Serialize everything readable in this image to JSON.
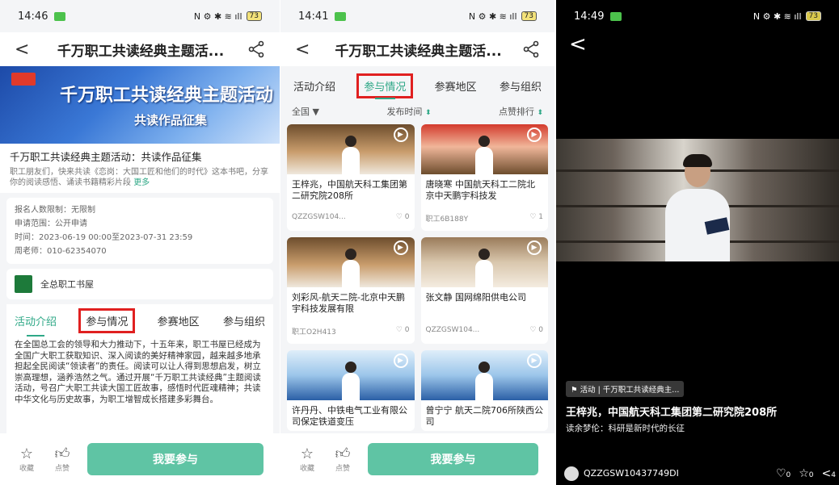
{
  "screen1": {
    "status": {
      "time": "14:46",
      "icons": "N ⚙ ✱ ≋ ıll",
      "battery": "73"
    },
    "nav": {
      "title": "千万职工共读经典主题活..."
    },
    "banner": {
      "line1": "千万职工共读经典主题活动",
      "line2": "共读作品征集"
    },
    "intro": {
      "title": "千万职工共读经典主题活动：共读作品征集",
      "desc": "职工朋友们，快来共读《恋岗：大国工匠和他们的时代》这本书吧，分享你的阅读感悟、诵读书籍精彩片段",
      "more": "更多"
    },
    "meta": {
      "limit": "报名人数限制：无限制",
      "scope": "申请范围：公开申请",
      "time": "时间：2023-06-19 00:00至2023-07-31 23:59",
      "contact": "周老师：010-62354070"
    },
    "org": {
      "name": "全总职工书屋"
    },
    "tabs": [
      "活动介绍",
      "参与情况",
      "参赛地区",
      "参与组织"
    ],
    "article": "在全国总工会的领导和大力推动下，十五年来，职工书屋已经成为全国广大职工获取知识、深入阅读的美好精神家园，越来越多地承担起全民阅读“领读者”的责任。阅读可以让人得到思想启发，树立崇高理想，涵养浩然之气。通过开展“千万职工共读经典”主题阅读活动，号召广大职工共读大国工匠故事，感悟时代匠魂精神；共读中华文化与历史故事，为职工增智成长搭建多彩舞台。",
    "bottom": {
      "fav": "收藏",
      "like": "点赞",
      "join": "我要参与"
    }
  },
  "screen2": {
    "status": {
      "time": "14:41",
      "icons": "N ⚙ ✱ ≋ ıll",
      "battery": "73"
    },
    "nav": {
      "title": "千万职工共读经典主题活..."
    },
    "tabs": [
      "活动介绍",
      "参与情况",
      "参赛地区",
      "参与组织"
    ],
    "filter": {
      "region": "全国",
      "time": "发布时间",
      "likes": "点赞排行"
    },
    "cards": [
      {
        "title": "王梓兆，中国航天科工集团第二研究院208所",
        "author": "QZZGSW104...",
        "likes": "0"
      },
      {
        "title": "唐晓寒 中国航天科工二院北京中天鹏宇科技发",
        "author": "职工6B188Y",
        "likes": "1"
      },
      {
        "title": "刘彩风-航天二院-北京中天鹏宇科技发展有限",
        "author": "职工O2H413",
        "likes": "0"
      },
      {
        "title": "张文静 国网绵阳供电公司",
        "author": "QZZGSW104...",
        "likes": "0"
      },
      {
        "title": "许丹丹、中铁电气工业有限公司保定铁道变压",
        "author": "",
        "likes": ""
      },
      {
        "title": "曾宁宁 航天二院706所陕西公司",
        "author": "",
        "likes": ""
      }
    ],
    "bottom": {
      "fav": "收藏",
      "like": "点赞",
      "join": "我要参与"
    }
  },
  "screen3": {
    "status": {
      "time": "14:49",
      "icons": "N ⚙ ✱ ≋ ıll",
      "battery": "73"
    },
    "tag": "活动 | 千万职工共读经典主...",
    "title": "王梓兆，中国航天科工集团第二研究院208所",
    "subtitle": "读余梦伦：科研是新时代的长征",
    "author": "QZZGSW10437749DI",
    "likes": "0",
    "favs": "0",
    "shares": "4"
  },
  "colors": {
    "accent": "#2fa887",
    "highlight": "#e02020",
    "button": "#5fc4a4"
  }
}
